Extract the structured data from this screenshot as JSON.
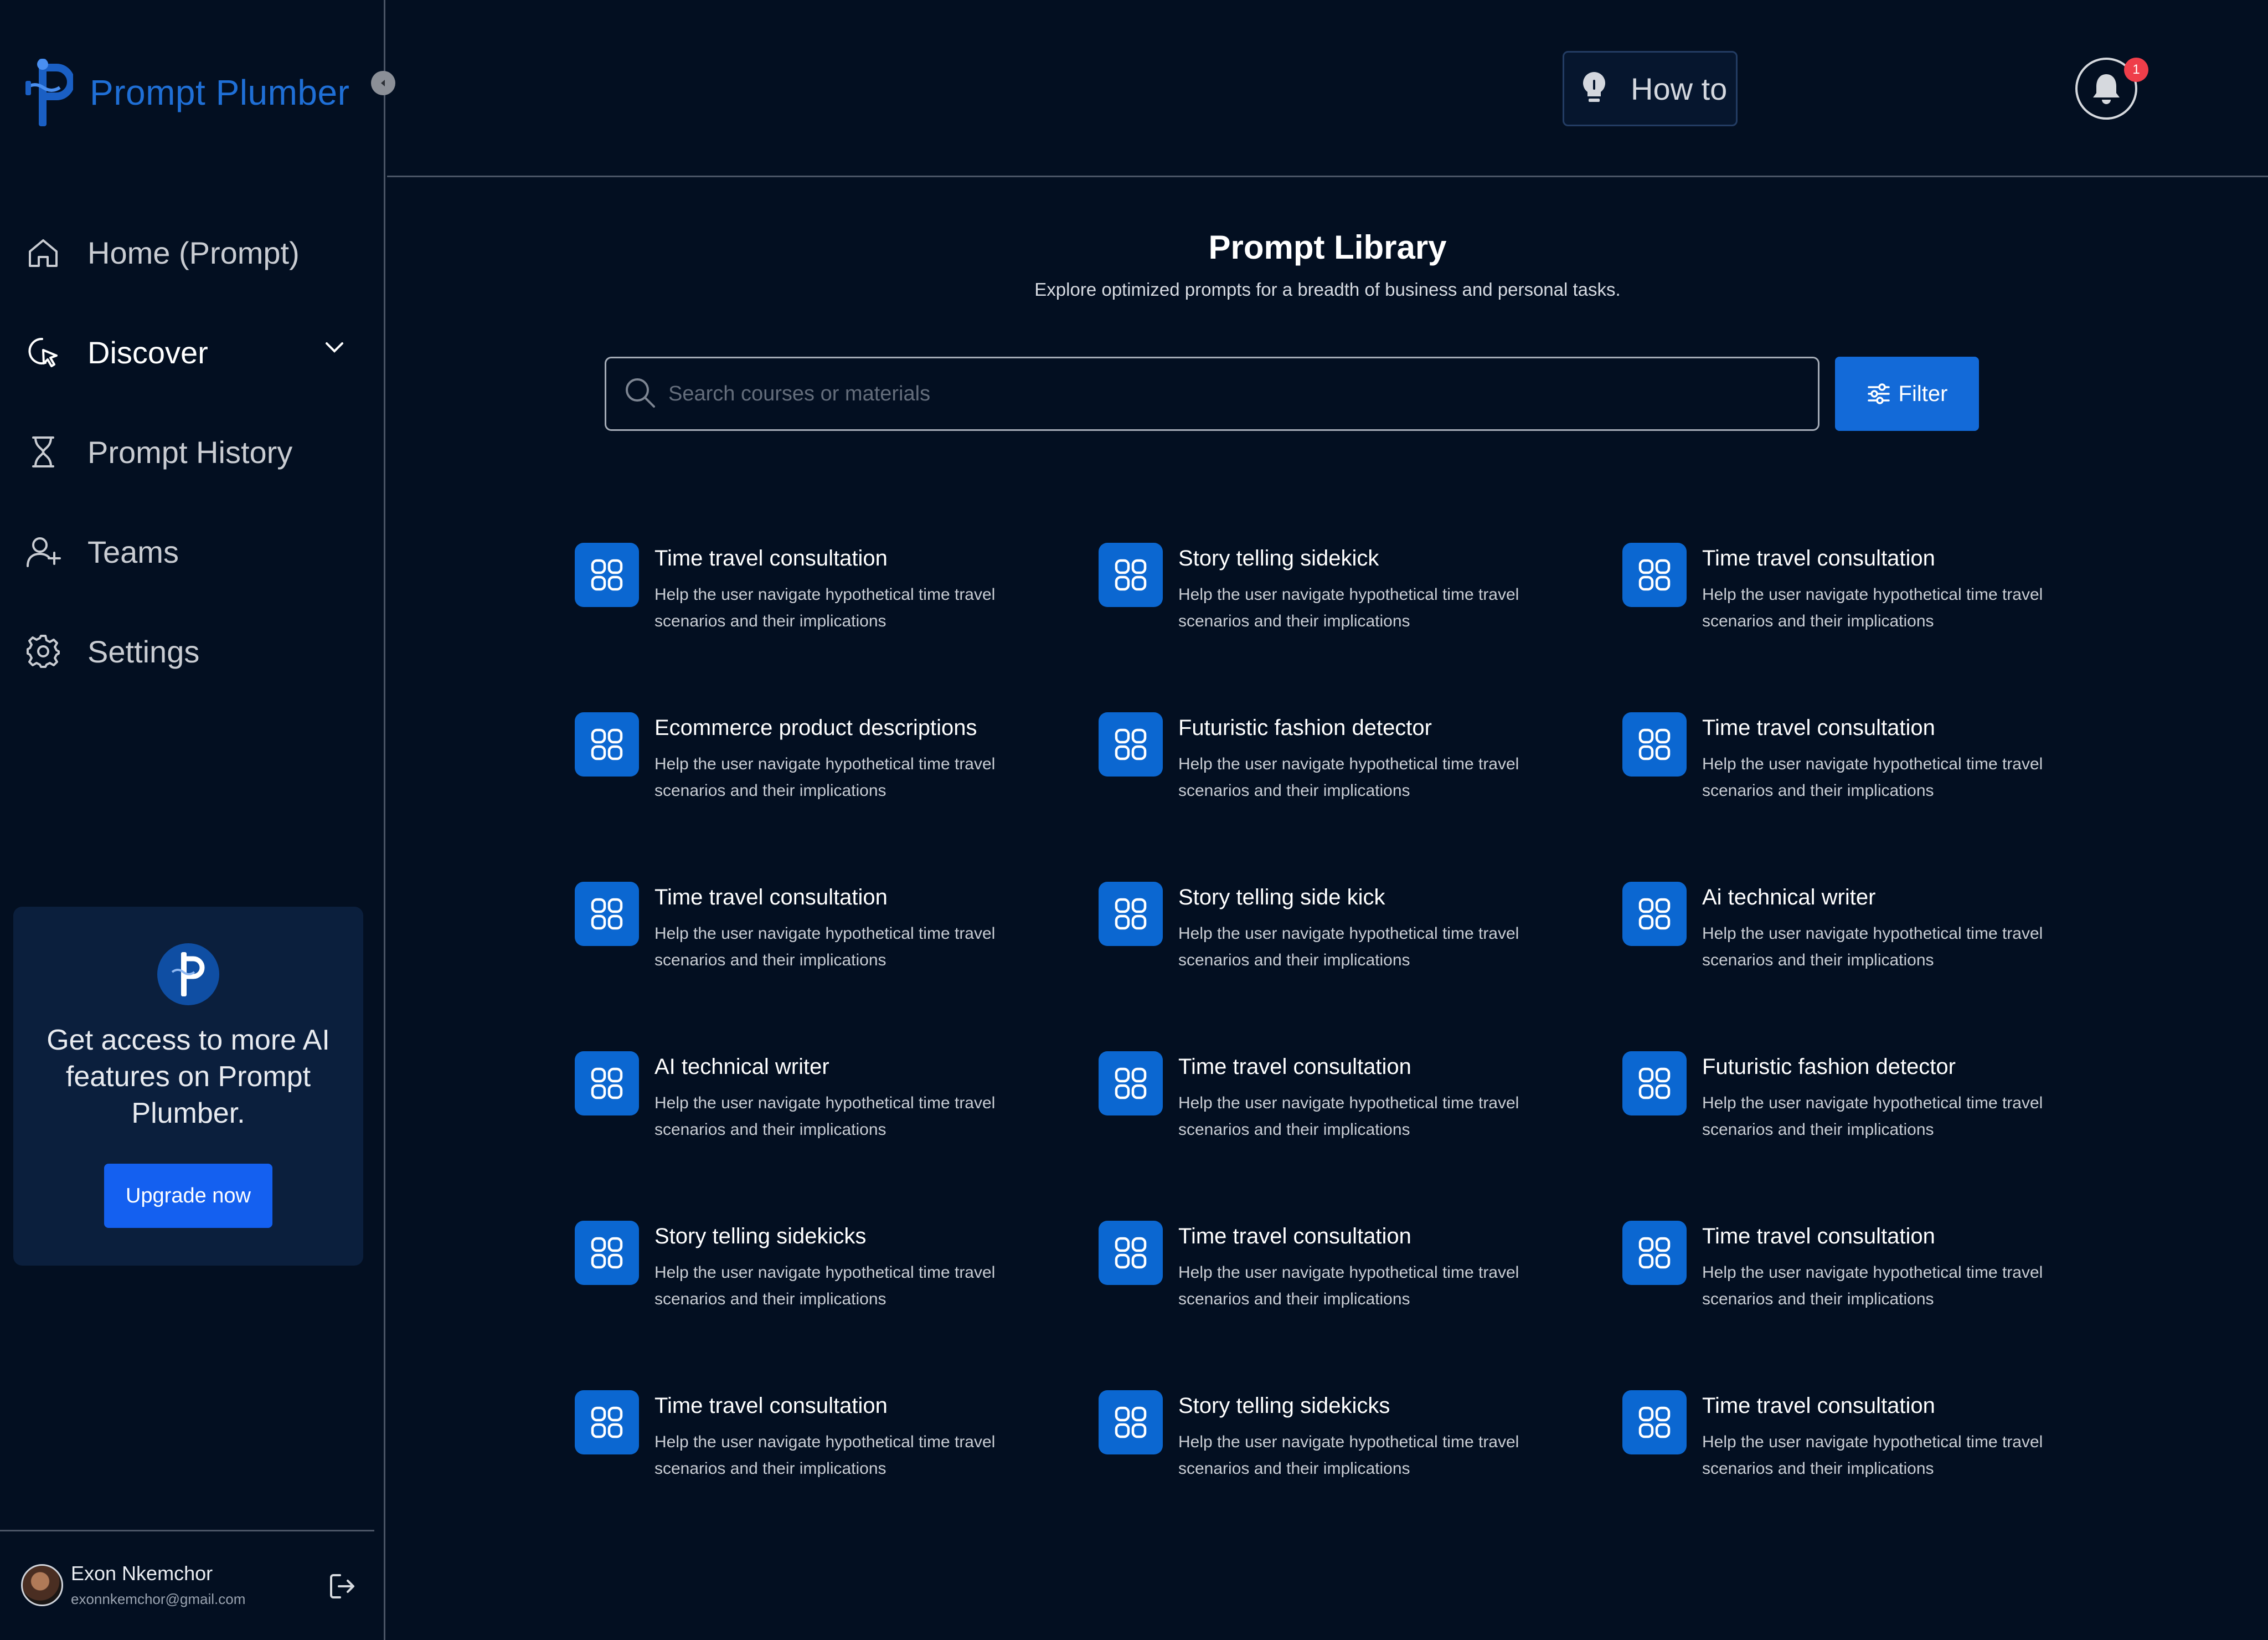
{
  "app": {
    "name": "Prompt Plumber",
    "brand_color": "#1f6fd6",
    "accent": "#1460f0"
  },
  "sidebar": {
    "items": [
      {
        "label": "Home (Prompt)",
        "icon": "home-icon"
      },
      {
        "label": "Discover",
        "icon": "cursor-click-icon",
        "has_chevron": true
      },
      {
        "label": "Prompt History",
        "icon": "hourglass-icon"
      },
      {
        "label": "Teams",
        "icon": "user-add-icon"
      },
      {
        "label": "Settings",
        "icon": "gear-icon"
      }
    ],
    "promo": {
      "text": "Get access to more AI features on Prompt Plumber.",
      "button": "Upgrade now"
    },
    "user": {
      "name": "Exon Nkemchor",
      "email": "exonnkemchor@gmail.com"
    }
  },
  "topbar": {
    "how_to": "How to",
    "notification_count": "1"
  },
  "library": {
    "title": "Prompt Library",
    "subtitle": "Explore optimized prompts for a breadth of business and personal tasks.",
    "search_placeholder": "Search courses or materials",
    "filter_label": "Filter"
  },
  "cards": [
    {
      "title": "Time travel consultation",
      "desc": "Help the user navigate hypothetical time travel scenarios and their implications"
    },
    {
      "title": "Story telling sidekick",
      "desc": "Help the user navigate hypothetical time travel scenarios and their implications"
    },
    {
      "title": "Time travel consultation",
      "desc": "Help the user navigate hypothetical time travel scenarios and their implications"
    },
    {
      "title": "Ecommerce product descriptions",
      "desc": "Help the user navigate hypothetical time travel scenarios and their implications"
    },
    {
      "title": "Futuristic fashion detector",
      "desc": "Help the user navigate hypothetical time travel scenarios and their implications"
    },
    {
      "title": "Time travel consultation",
      "desc": "Help the user navigate hypothetical time travel scenarios and their implications"
    },
    {
      "title": "Time travel consultation",
      "desc": "Help the user navigate hypothetical time travel scenarios and their implications"
    },
    {
      "title": "Story telling side kick",
      "desc": "Help the user navigate hypothetical time travel scenarios and their implications"
    },
    {
      "title": "Ai technical writer",
      "desc": "Help the user navigate hypothetical time travel scenarios and their implications"
    },
    {
      "title": "AI technical writer",
      "desc": "Help the user navigate hypothetical time travel scenarios and their implications"
    },
    {
      "title": "Time travel consultation",
      "desc": "Help the user navigate hypothetical time travel scenarios and their implications"
    },
    {
      "title": "Futuristic fashion detector",
      "desc": "Help the user navigate hypothetical time travel scenarios and their implications"
    },
    {
      "title": "Story telling sidekicks",
      "desc": "Help the user navigate hypothetical time travel scenarios and their implications"
    },
    {
      "title": "Time travel consultation",
      "desc": "Help the user navigate hypothetical time travel scenarios and their implications"
    },
    {
      "title": "Time travel consultation",
      "desc": "Help the user navigate hypothetical time travel scenarios and their implications"
    },
    {
      "title": "Time travel consultation",
      "desc": "Help the user navigate hypothetical time travel scenarios and their implications"
    },
    {
      "title": "Story telling sidekicks",
      "desc": "Help the user navigate hypothetical time travel scenarios and their implications"
    },
    {
      "title": "Time travel consultation",
      "desc": "Help the user navigate hypothetical time travel scenarios and their implications"
    }
  ]
}
